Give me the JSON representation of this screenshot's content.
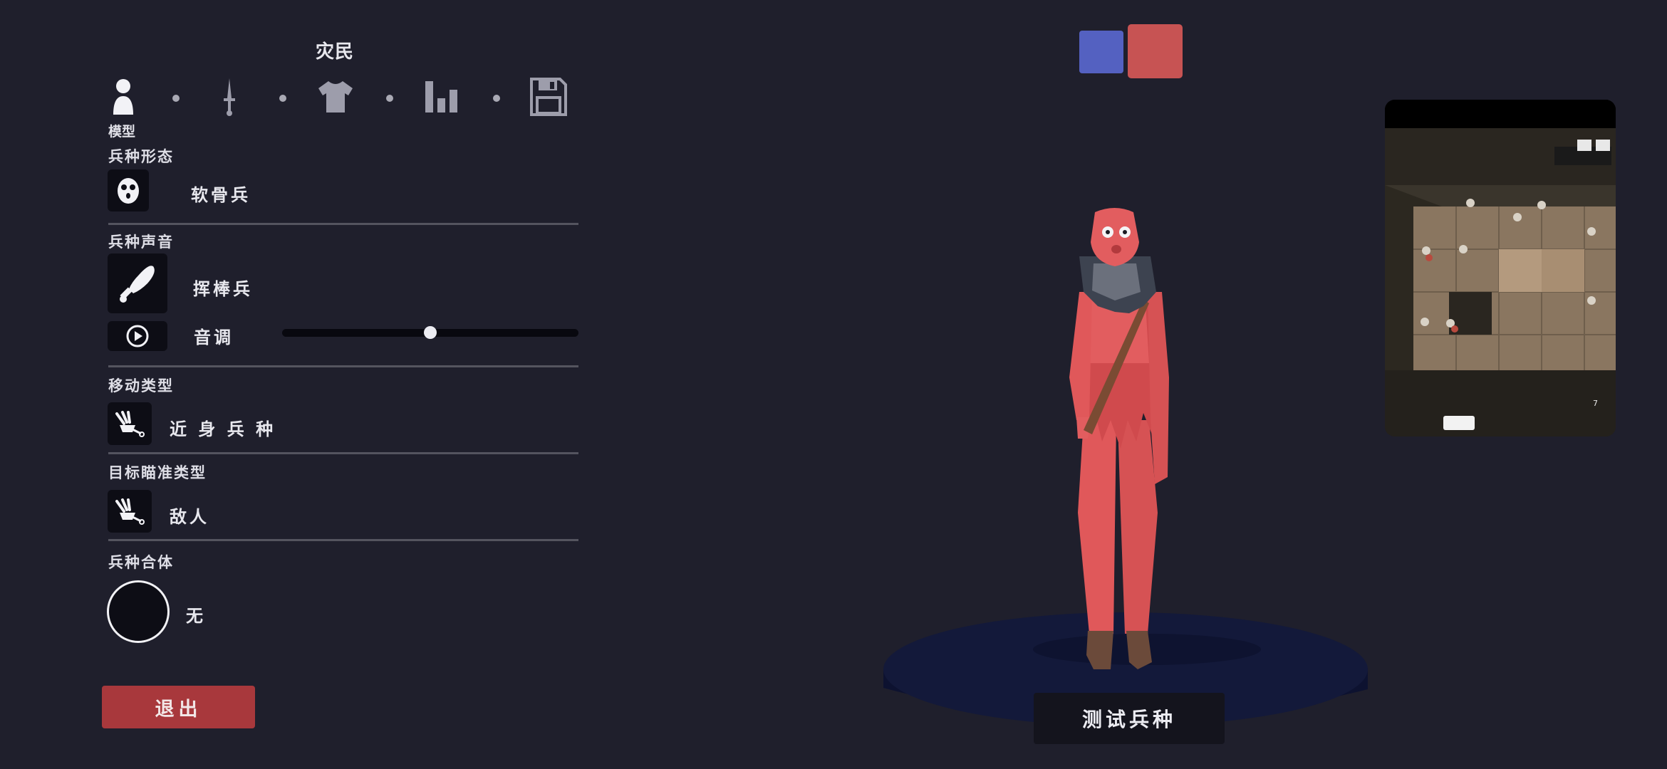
{
  "title": "灾民",
  "steps": {
    "current_label": "模型",
    "icons": [
      "person-icon",
      "sword-icon",
      "shirt-icon",
      "stats-icon",
      "save-icon"
    ]
  },
  "form": {
    "label": "兵种形态",
    "value": "软骨兵"
  },
  "voice": {
    "label": "兵种声音",
    "value": "挥棒兵",
    "pitch_label": "音调",
    "pitch_value": 0.5
  },
  "movement": {
    "label": "移动类型",
    "value": "近 身 兵 种"
  },
  "targeting": {
    "label": "目标瞄准类型",
    "value": "敌人"
  },
  "combine": {
    "label": "兵种合体",
    "value": "无"
  },
  "buttons": {
    "exit": "退出",
    "test": "测试兵种"
  },
  "colors": {
    "background": "#1f1f2c",
    "team_blue": "#5461c1",
    "team_red": "#c75353",
    "exit_button": "#a8383c",
    "unit_body": "#e0585a",
    "pedestal": "#13193a"
  },
  "preview": {
    "counter": "7"
  }
}
